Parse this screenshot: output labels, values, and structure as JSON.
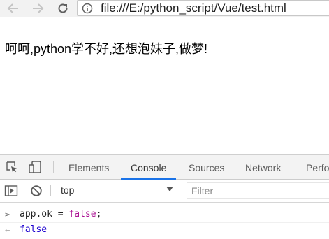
{
  "browser": {
    "back_icon": "arrow-left-icon",
    "forward_icon": "arrow-right-icon",
    "reload_icon": "reload-icon",
    "info_icon": "info-icon",
    "url": "file:///E:/python_script/Vue/test.html"
  },
  "page": {
    "message": "呵呵,python学不好,还想泡妹子,做梦!"
  },
  "devtools": {
    "tabs": [
      "Elements",
      "Console",
      "Sources",
      "Network",
      "Perfo"
    ],
    "active_tab": "Console",
    "toolbar_icons": [
      "inspect-element-icon",
      "device-toolbar-icon"
    ],
    "accent_color": "#1a73e8",
    "console": {
      "sidebar_icon": "sidebar-toggle-icon",
      "clear_icon": "clear-console-icon",
      "context": "top",
      "filter_placeholder": "Filter",
      "entries": [
        {
          "prompt": "≥",
          "ident": "app.ok",
          "op": " = ",
          "value": "false",
          "tail": ";"
        },
        {
          "prompt": "←",
          "result": "false"
        }
      ]
    }
  }
}
